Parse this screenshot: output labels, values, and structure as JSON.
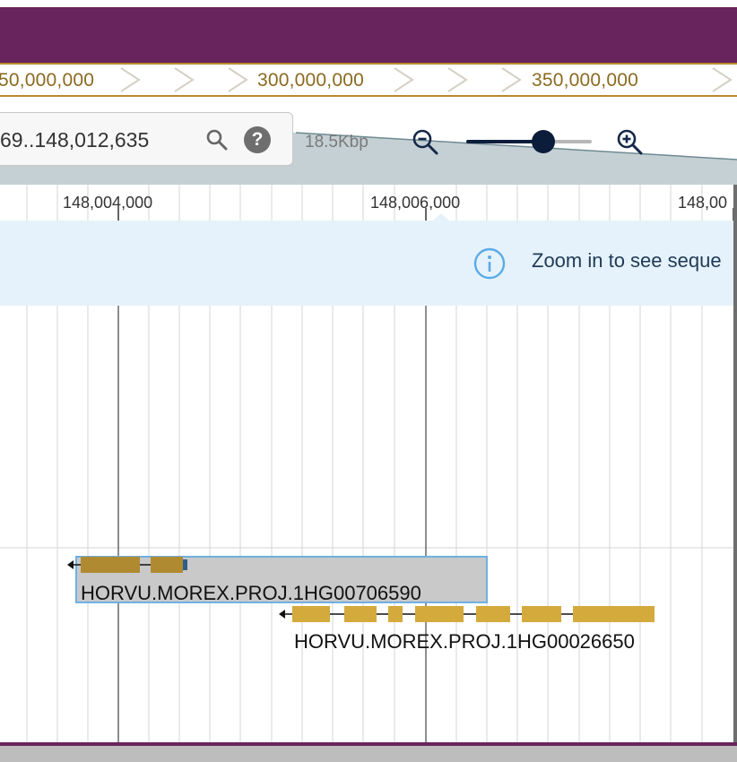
{
  "overview": {
    "labels": [
      "50,000,000",
      "300,000,000",
      "350,000,000"
    ]
  },
  "navigation": {
    "location_value": "69..148,012,635",
    "help_label": "?",
    "bp_width": "18.5Kbp",
    "zoom_level": 0.62
  },
  "scale": {
    "ticks": [
      "148,004,000",
      "148,006,000",
      "148,00"
    ]
  },
  "info": {
    "message": "Zoom in to see seque"
  },
  "genes": [
    {
      "name": "HORVU.MOREX.PROJ.1HG00706590",
      "strand": "-"
    },
    {
      "name": "HORVU.MOREX.PROJ.1HG00026650",
      "strand": "-"
    }
  ],
  "colors": {
    "header": "#68245c",
    "overview_label": "#8b6a1f",
    "exon_selected": "#b08a30",
    "exon": "#d4aa3c",
    "selection_border": "#6fb0e4",
    "info_background": "#e5f2fb",
    "info_icon": "#5aaae6"
  },
  "icons": {
    "search": "search-icon",
    "help": "help-icon",
    "zoom_out": "zoom-out-icon",
    "zoom_in": "zoom-in-icon",
    "info": "info-icon"
  }
}
